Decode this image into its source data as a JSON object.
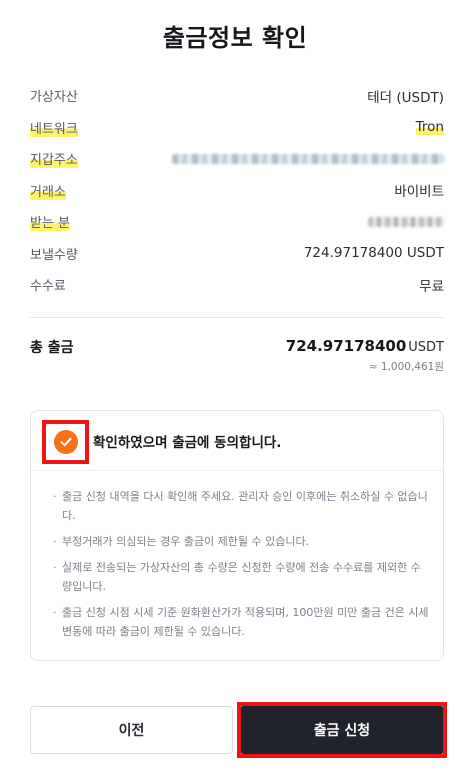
{
  "title": "출금정보 확인",
  "details": [
    {
      "label": "가상자산",
      "value": "테더 (USDT)"
    },
    {
      "label": "네트워크",
      "value": "Tron"
    },
    {
      "label": "지갑주소",
      "value": ""
    },
    {
      "label": "거래소",
      "value": "바이비트"
    },
    {
      "label": "받는 분",
      "value": ""
    },
    {
      "label": "보낼수량",
      "value": "724.97178400 USDT"
    },
    {
      "label": "수수료",
      "value": "무료"
    }
  ],
  "total": {
    "label": "총 출금",
    "amount": "724.97178400",
    "unit": "USDT",
    "krw": "≈ 1,000,461원"
  },
  "confirm": {
    "checked": true,
    "agree_text": "확인하였으며 출금에 동의합니다.",
    "notes": [
      "출금 신청 내역을 다시 확인해 주세요. 관리자 승인 이후에는 취소하실 수 없습니다.",
      "부정거래가 의심되는 경우 출금이 제한될 수 있습니다.",
      "실제로 전송되는 가상자산의 총 수량은 신청한 수량에 전송 수수료를 제외한 수량입니다.",
      "출금 신청 시점 시세 기준 원화환산가가 적용되며, 100만원 미만 출금 건은 시세 변동에 따라 출금이 제한될 수 있습니다."
    ]
  },
  "buttons": {
    "prev_label": "이전",
    "submit_label": "출금 신청"
  },
  "colors": {
    "accent_orange": "#f77214",
    "highlight": "#f01313",
    "primary_button": "#20232b"
  },
  "icons": {
    "check": "check-icon"
  }
}
